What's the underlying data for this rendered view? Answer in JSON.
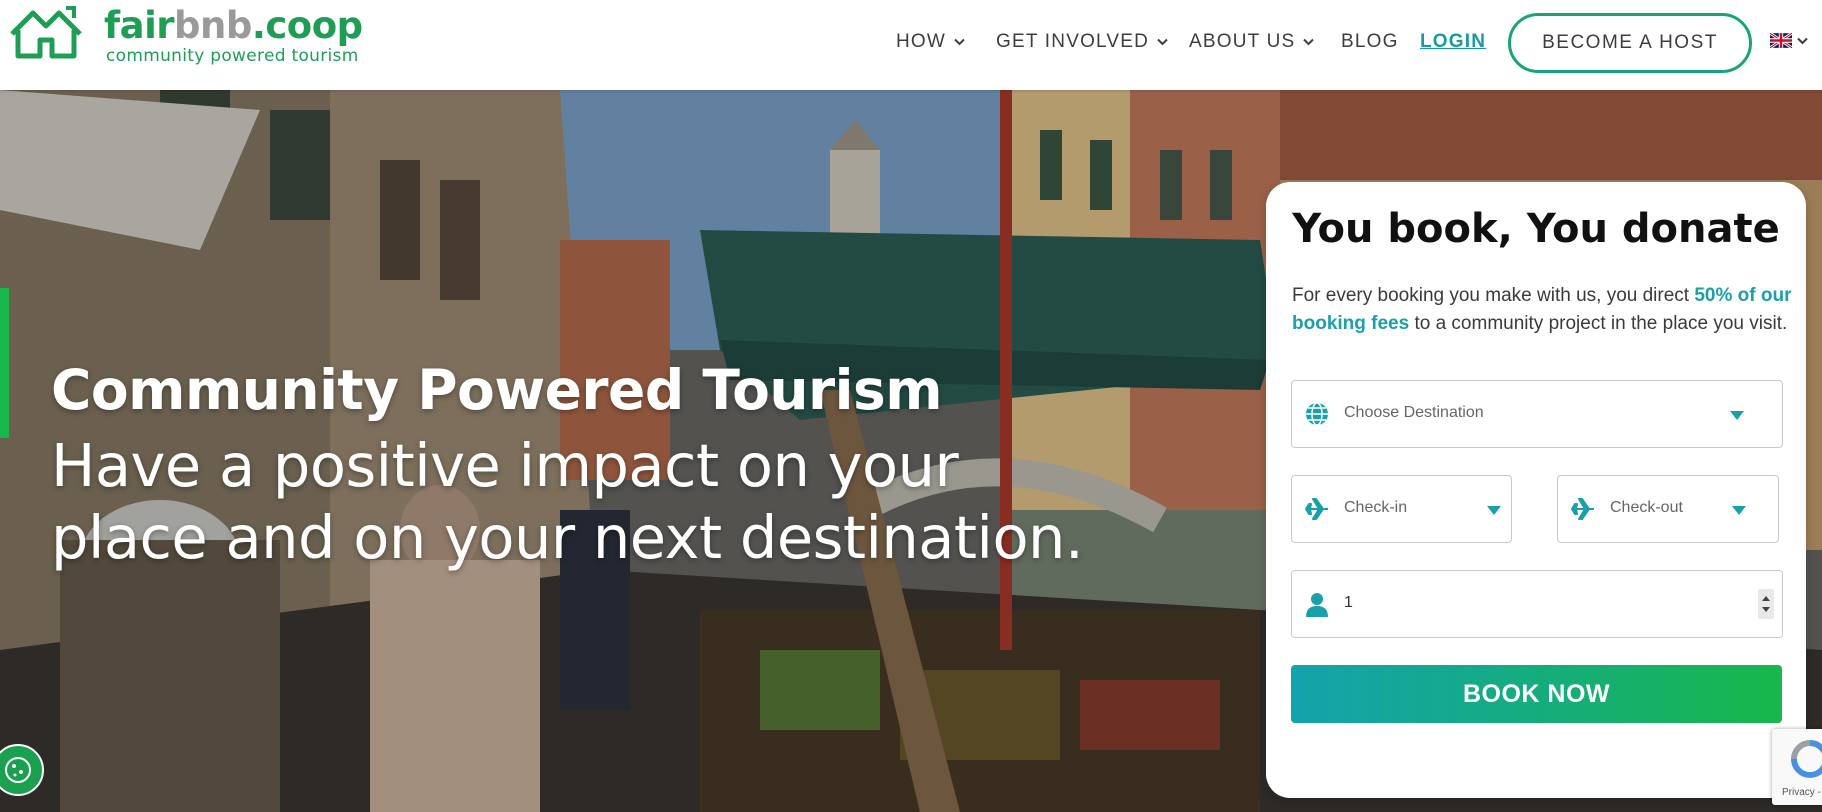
{
  "brand": {
    "name_part1": "fair",
    "name_part2": "bnb",
    "name_part3": ".coop",
    "tagline": "community powered tourism",
    "green": "#1f9d55",
    "teal": "#1a9aa0"
  },
  "nav": {
    "items": [
      {
        "label": "HOW",
        "has_dropdown": true
      },
      {
        "label": "GET INVOLVED",
        "has_dropdown": true
      },
      {
        "label": "ABOUT US",
        "has_dropdown": true
      },
      {
        "label": "BLOG",
        "has_dropdown": false
      }
    ],
    "login": "LOGIN",
    "become_host": "BECOME A HOST",
    "language_icon": "uk-flag-icon"
  },
  "hero": {
    "title": "Community Powered Tourism",
    "subtitle": "Have a positive impact on your place and on your next destination."
  },
  "booking": {
    "title": "You book, You donate",
    "desc_before": "For every booking you make with us, you direct ",
    "desc_highlight": "50% of our booking fees",
    "desc_after": " to a community project in the place you visit.",
    "destination_placeholder": "Choose Destination",
    "checkin_placeholder": "Check-in",
    "checkout_placeholder": "Check-out",
    "guests_value": "1",
    "book_button": "BOOK NOW"
  },
  "recaptcha": {
    "label": "Privacy - Te"
  }
}
